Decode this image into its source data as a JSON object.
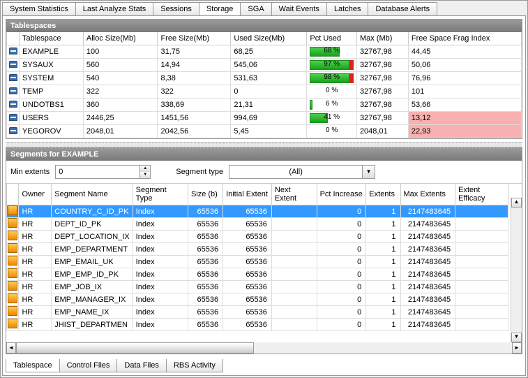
{
  "tabs_top": [
    "System Statistics",
    "Last Analyze Stats",
    "Sessions",
    "Storage",
    "SGA",
    "Wait Events",
    "Latches",
    "Database Alerts"
  ],
  "tabs_top_active": 3,
  "tablespaces": {
    "title": "Tablespaces",
    "headers": [
      "Tablespace",
      "Alloc Size(Mb)",
      "Free Size(Mb)",
      "Used Size(Mb)",
      "Pct Used",
      "Max (Mb)",
      "Free Space Frag Index"
    ],
    "rows": [
      {
        "name": "EXAMPLE",
        "alloc": "100",
        "free": "31,75",
        "used": "68,25",
        "pct": "68 %",
        "pctv": 68,
        "redcap": false,
        "max": "32767,98",
        "frag": "44,45",
        "fragred": false
      },
      {
        "name": "SYSAUX",
        "alloc": "560",
        "free": "14,94",
        "used": "545,06",
        "pct": "97 %",
        "pctv": 97,
        "redcap": true,
        "max": "32767,98",
        "frag": "50,06",
        "fragred": false
      },
      {
        "name": "SYSTEM",
        "alloc": "540",
        "free": "8,38",
        "used": "531,63",
        "pct": "98 %",
        "pctv": 98,
        "redcap": true,
        "max": "32767,98",
        "frag": "76,96",
        "fragred": false
      },
      {
        "name": "TEMP",
        "alloc": "322",
        "free": "322",
        "used": "0",
        "pct": "0 %",
        "pctv": 0,
        "redcap": false,
        "max": "32767,98",
        "frag": "101",
        "fragred": false
      },
      {
        "name": "UNDOTBS1",
        "alloc": "360",
        "free": "338,69",
        "used": "21,31",
        "pct": "6 %",
        "pctv": 6,
        "redcap": false,
        "max": "32767,98",
        "frag": "53,66",
        "fragred": false
      },
      {
        "name": "USERS",
        "alloc": "2446,25",
        "free": "1451,56",
        "used": "994,69",
        "pct": "41 %",
        "pctv": 41,
        "redcap": false,
        "max": "32767,98",
        "frag": "13,12",
        "fragred": true
      },
      {
        "name": "YEGOROV",
        "alloc": "2048,01",
        "free": "2042,56",
        "used": "5,45",
        "pct": "0 %",
        "pctv": 0,
        "redcap": false,
        "max": "2048,01",
        "frag": "22,93",
        "fragred": true
      }
    ]
  },
  "segments": {
    "title": "Segments for EXAMPLE",
    "filter": {
      "min_extents_label": "Min extents",
      "min_extents_value": "0",
      "segment_type_label": "Segment type",
      "segment_type_value": "(All)"
    },
    "headers": [
      "Owner",
      "Segment Name",
      "Segment Type",
      "Size (b)",
      "Initial Extent",
      "Next Extent",
      "Pct Increase",
      "Extents",
      "Max Extents",
      "Extent Efficacy"
    ],
    "rows": [
      {
        "owner": "HR",
        "name": "COUNTRY_C_ID_PK",
        "type": "Index",
        "size": "65536",
        "init": "65536",
        "next": "",
        "pct": "0",
        "ext": "1",
        "max": "2147483645",
        "eff": "",
        "sel": true
      },
      {
        "owner": "HR",
        "name": "DEPT_ID_PK",
        "type": "Index",
        "size": "65536",
        "init": "65536",
        "next": "",
        "pct": "0",
        "ext": "1",
        "max": "2147483645",
        "eff": "",
        "sel": false
      },
      {
        "owner": "HR",
        "name": "DEPT_LOCATION_IX",
        "type": "Index",
        "size": "65536",
        "init": "65536",
        "next": "",
        "pct": "0",
        "ext": "1",
        "max": "2147483645",
        "eff": "",
        "sel": false
      },
      {
        "owner": "HR",
        "name": "EMP_DEPARTMENT",
        "type": "Index",
        "size": "65536",
        "init": "65536",
        "next": "",
        "pct": "0",
        "ext": "1",
        "max": "2147483645",
        "eff": "",
        "sel": false
      },
      {
        "owner": "HR",
        "name": "EMP_EMAIL_UK",
        "type": "Index",
        "size": "65536",
        "init": "65536",
        "next": "",
        "pct": "0",
        "ext": "1",
        "max": "2147483645",
        "eff": "",
        "sel": false
      },
      {
        "owner": "HR",
        "name": "EMP_EMP_ID_PK",
        "type": "Index",
        "size": "65536",
        "init": "65536",
        "next": "",
        "pct": "0",
        "ext": "1",
        "max": "2147483645",
        "eff": "",
        "sel": false
      },
      {
        "owner": "HR",
        "name": "EMP_JOB_IX",
        "type": "Index",
        "size": "65536",
        "init": "65536",
        "next": "",
        "pct": "0",
        "ext": "1",
        "max": "2147483645",
        "eff": "",
        "sel": false
      },
      {
        "owner": "HR",
        "name": "EMP_MANAGER_IX",
        "type": "Index",
        "size": "65536",
        "init": "65536",
        "next": "",
        "pct": "0",
        "ext": "1",
        "max": "2147483645",
        "eff": "",
        "sel": false
      },
      {
        "owner": "HR",
        "name": "EMP_NAME_IX",
        "type": "Index",
        "size": "65536",
        "init": "65536",
        "next": "",
        "pct": "0",
        "ext": "1",
        "max": "2147483645",
        "eff": "",
        "sel": false
      },
      {
        "owner": "HR",
        "name": "JHIST_DEPARTMEN",
        "type": "Index",
        "size": "65536",
        "init": "65536",
        "next": "",
        "pct": "0",
        "ext": "1",
        "max": "2147483645",
        "eff": "",
        "sel": false
      }
    ]
  },
  "tabs_bottom": [
    "Tablespace",
    "Control Files",
    "Data Files",
    "RBS Activity"
  ],
  "tabs_bottom_active": 0
}
